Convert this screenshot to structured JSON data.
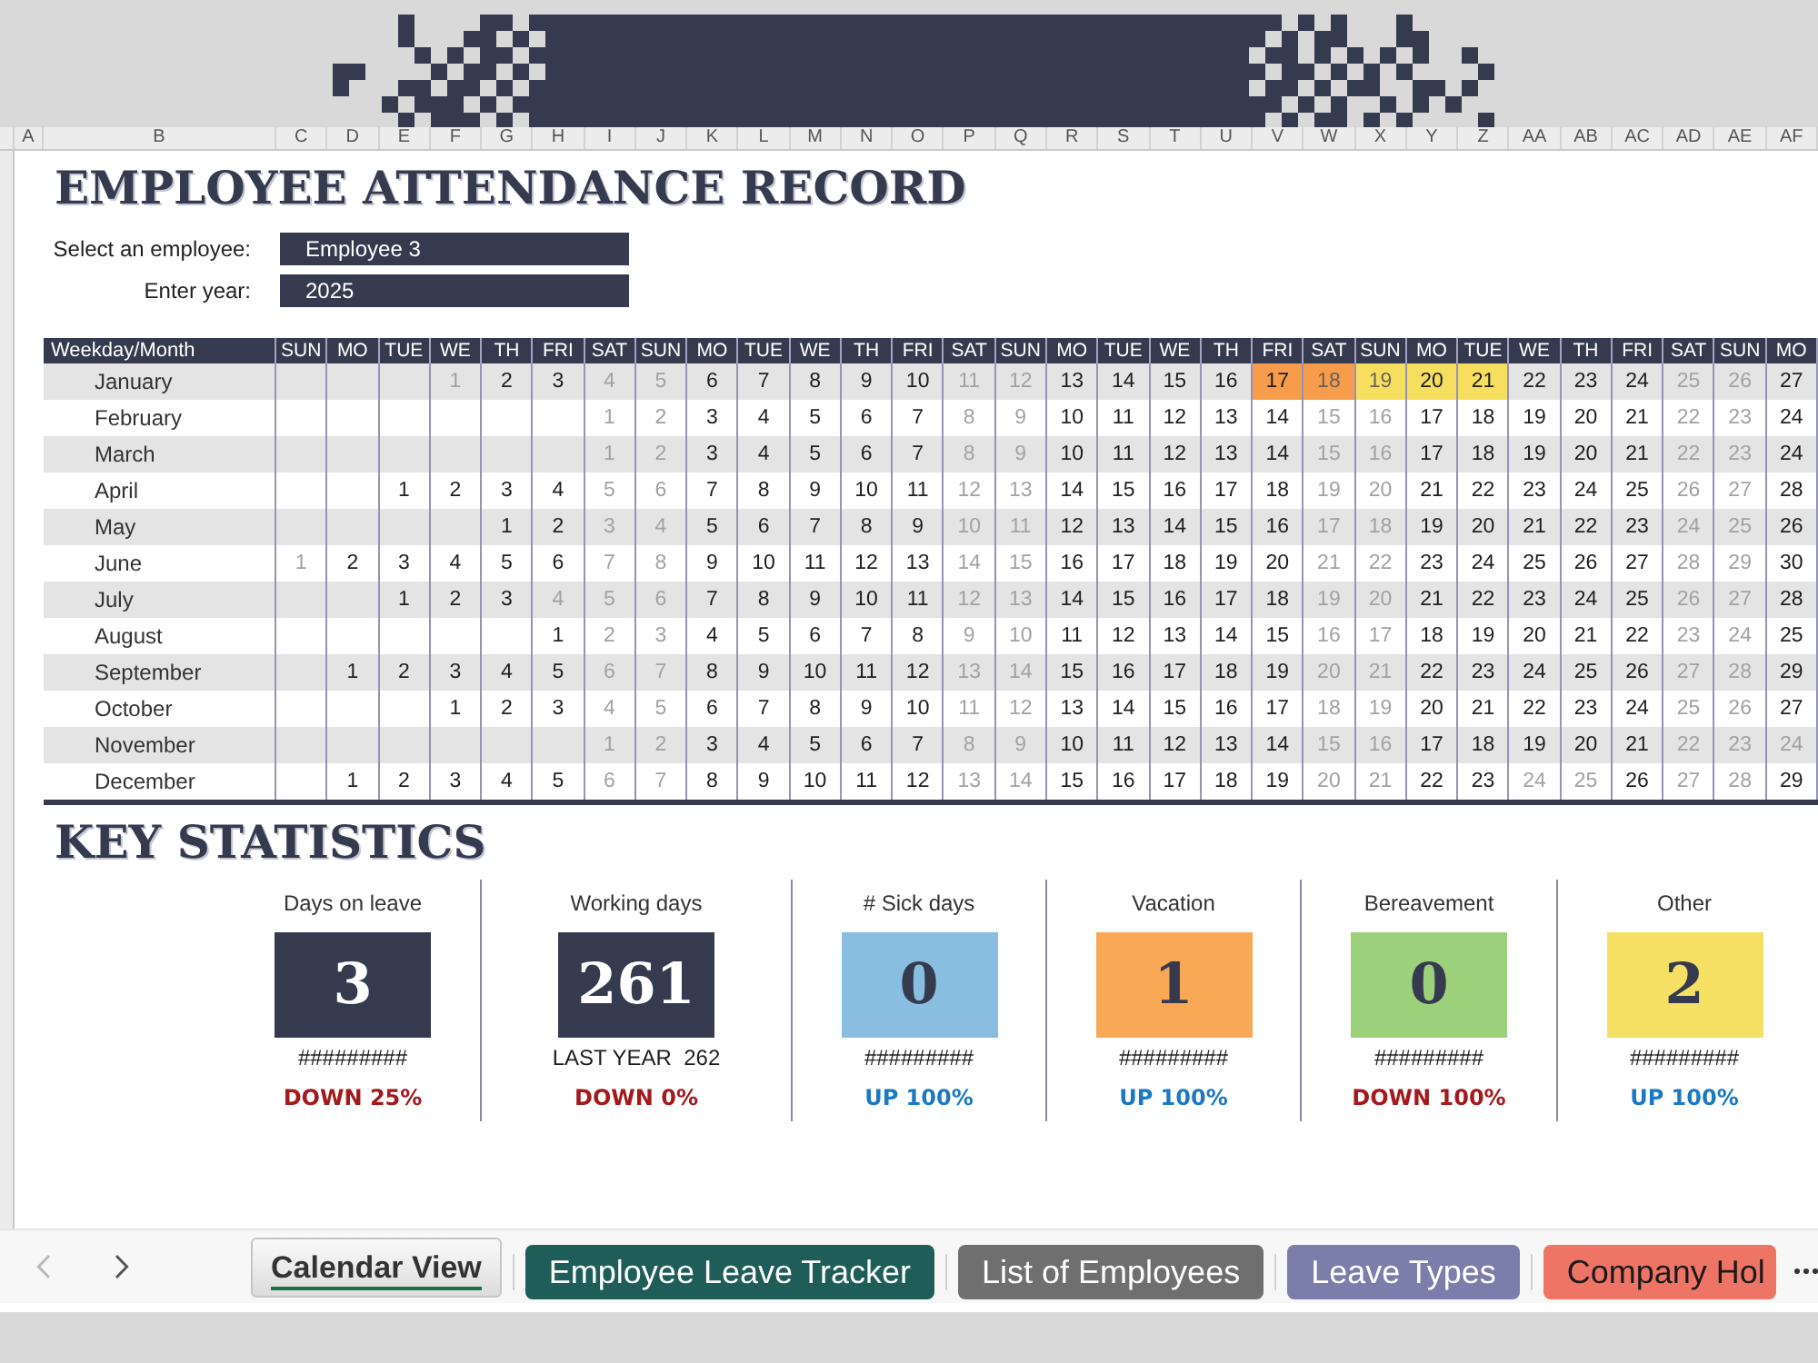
{
  "column_headers": [
    "A",
    "B",
    "C",
    "D",
    "E",
    "F",
    "G",
    "H",
    "I",
    "J",
    "K",
    "L",
    "M",
    "N",
    "O",
    "P",
    "Q",
    "R",
    "S",
    "T",
    "U",
    "V",
    "W",
    "X",
    "Y",
    "Z",
    "AA",
    "AB",
    "AC",
    "AD",
    "AE",
    "AF"
  ],
  "title": "EMPLOYEE ATTENDANCE RECORD",
  "selectors": [
    {
      "label": "Select an employee:",
      "value": "Employee 3"
    },
    {
      "label": "Enter year:",
      "value": "2025"
    }
  ],
  "calendar": {
    "corner": "Weekday/Month",
    "weekdays": [
      "SUN",
      "MO",
      "TUE",
      "WE",
      "TH",
      "FRI",
      "SAT",
      "SUN",
      "MO",
      "TUE",
      "WE",
      "TH",
      "FRI",
      "SAT",
      "SUN",
      "MO",
      "TUE",
      "WE",
      "TH",
      "FRI",
      "SAT",
      "SUN",
      "MO",
      "TUE",
      "WE",
      "TH",
      "FRI",
      "SAT",
      "SUN",
      "MO"
    ],
    "months": [
      {
        "name": "January",
        "days": [
          {
            "kind": "blank"
          },
          {
            "kind": "blank"
          },
          {
            "kind": "blank"
          },
          {
            "kind": "day",
            "day": "1",
            "off": true
          },
          {
            "kind": "day",
            "day": "2",
            "off": false
          },
          {
            "kind": "day",
            "day": "3",
            "off": false
          },
          {
            "kind": "day",
            "day": "4",
            "off": true
          },
          {
            "kind": "day",
            "day": "5",
            "off": true
          },
          {
            "kind": "day",
            "day": "6",
            "off": false
          },
          {
            "kind": "day",
            "day": "7",
            "off": false
          },
          {
            "kind": "day",
            "day": "8",
            "off": false
          },
          {
            "kind": "day",
            "day": "9",
            "off": false
          },
          {
            "kind": "day",
            "day": "10",
            "off": false
          },
          {
            "kind": "day",
            "day": "11",
            "off": true
          },
          {
            "kind": "day",
            "day": "12",
            "off": true
          },
          {
            "kind": "day",
            "day": "13",
            "off": false
          },
          {
            "kind": "day",
            "day": "14",
            "off": false
          },
          {
            "kind": "day",
            "day": "15",
            "off": false
          },
          {
            "kind": "day",
            "day": "16",
            "off": false
          },
          {
            "kind": "day",
            "day": "17",
            "off": false,
            "color": "#f79c4a"
          },
          {
            "kind": "day",
            "day": "18",
            "off": true,
            "color": "#f79c4a"
          },
          {
            "kind": "day",
            "day": "19",
            "off": true,
            "color": "#f6df5f"
          },
          {
            "kind": "day",
            "day": "20",
            "off": false,
            "color": "#f6df5f"
          },
          {
            "kind": "day",
            "day": "21",
            "off": false,
            "color": "#f6df5f"
          },
          {
            "kind": "day",
            "day": "22",
            "off": false
          },
          {
            "kind": "day",
            "day": "23",
            "off": false
          },
          {
            "kind": "day",
            "day": "24",
            "off": false
          },
          {
            "kind": "day",
            "day": "25",
            "off": true
          },
          {
            "kind": "day",
            "day": "26",
            "off": true
          },
          {
            "kind": "day",
            "day": "27",
            "off": false
          }
        ]
      },
      {
        "name": "February",
        "days": [
          {
            "kind": "blank"
          },
          {
            "kind": "blank"
          },
          {
            "kind": "blank"
          },
          {
            "kind": "blank"
          },
          {
            "kind": "blank"
          },
          {
            "kind": "blank"
          },
          {
            "kind": "day",
            "day": "1",
            "off": true
          },
          {
            "kind": "day",
            "day": "2",
            "off": true
          },
          {
            "kind": "day",
            "day": "3",
            "off": false
          },
          {
            "kind": "day",
            "day": "4",
            "off": false
          },
          {
            "kind": "day",
            "day": "5",
            "off": false
          },
          {
            "kind": "day",
            "day": "6",
            "off": false
          },
          {
            "kind": "day",
            "day": "7",
            "off": false
          },
          {
            "kind": "day",
            "day": "8",
            "off": true
          },
          {
            "kind": "day",
            "day": "9",
            "off": true
          },
          {
            "kind": "day",
            "day": "10",
            "off": false
          },
          {
            "kind": "day",
            "day": "11",
            "off": false
          },
          {
            "kind": "day",
            "day": "12",
            "off": false
          },
          {
            "kind": "day",
            "day": "13",
            "off": false
          },
          {
            "kind": "day",
            "day": "14",
            "off": false
          },
          {
            "kind": "day",
            "day": "15",
            "off": true
          },
          {
            "kind": "day",
            "day": "16",
            "off": true
          },
          {
            "kind": "day",
            "day": "17",
            "off": false
          },
          {
            "kind": "day",
            "day": "18",
            "off": false
          },
          {
            "kind": "day",
            "day": "19",
            "off": false
          },
          {
            "kind": "day",
            "day": "20",
            "off": false
          },
          {
            "kind": "day",
            "day": "21",
            "off": false
          },
          {
            "kind": "day",
            "day": "22",
            "off": true
          },
          {
            "kind": "day",
            "day": "23",
            "off": true
          },
          {
            "kind": "day",
            "day": "24",
            "off": false
          }
        ]
      },
      {
        "name": "March",
        "days": [
          {
            "kind": "blank"
          },
          {
            "kind": "blank"
          },
          {
            "kind": "blank"
          },
          {
            "kind": "blank"
          },
          {
            "kind": "blank"
          },
          {
            "kind": "blank"
          },
          {
            "kind": "day",
            "day": "1",
            "off": true
          },
          {
            "kind": "day",
            "day": "2",
            "off": true
          },
          {
            "kind": "day",
            "day": "3",
            "off": false
          },
          {
            "kind": "day",
            "day": "4",
            "off": false
          },
          {
            "kind": "day",
            "day": "5",
            "off": false
          },
          {
            "kind": "day",
            "day": "6",
            "off": false
          },
          {
            "kind": "day",
            "day": "7",
            "off": false
          },
          {
            "kind": "day",
            "day": "8",
            "off": true
          },
          {
            "kind": "day",
            "day": "9",
            "off": true
          },
          {
            "kind": "day",
            "day": "10",
            "off": false
          },
          {
            "kind": "day",
            "day": "11",
            "off": false
          },
          {
            "kind": "day",
            "day": "12",
            "off": false
          },
          {
            "kind": "day",
            "day": "13",
            "off": false
          },
          {
            "kind": "day",
            "day": "14",
            "off": false
          },
          {
            "kind": "day",
            "day": "15",
            "off": true
          },
          {
            "kind": "day",
            "day": "16",
            "off": true
          },
          {
            "kind": "day",
            "day": "17",
            "off": false
          },
          {
            "kind": "day",
            "day": "18",
            "off": false
          },
          {
            "kind": "day",
            "day": "19",
            "off": false
          },
          {
            "kind": "day",
            "day": "20",
            "off": false
          },
          {
            "kind": "day",
            "day": "21",
            "off": false
          },
          {
            "kind": "day",
            "day": "22",
            "off": true
          },
          {
            "kind": "day",
            "day": "23",
            "off": true
          },
          {
            "kind": "day",
            "day": "24",
            "off": false
          }
        ]
      },
      {
        "name": "April",
        "days": [
          {
            "kind": "blank"
          },
          {
            "kind": "blank"
          },
          {
            "kind": "day",
            "day": "1",
            "off": false
          },
          {
            "kind": "day",
            "day": "2",
            "off": false
          },
          {
            "kind": "day",
            "day": "3",
            "off": false
          },
          {
            "kind": "day",
            "day": "4",
            "off": false
          },
          {
            "kind": "day",
            "day": "5",
            "off": true
          },
          {
            "kind": "day",
            "day": "6",
            "off": true
          },
          {
            "kind": "day",
            "day": "7",
            "off": false
          },
          {
            "kind": "day",
            "day": "8",
            "off": false
          },
          {
            "kind": "day",
            "day": "9",
            "off": false
          },
          {
            "kind": "day",
            "day": "10",
            "off": false
          },
          {
            "kind": "day",
            "day": "11",
            "off": false
          },
          {
            "kind": "day",
            "day": "12",
            "off": true
          },
          {
            "kind": "day",
            "day": "13",
            "off": true
          },
          {
            "kind": "day",
            "day": "14",
            "off": false
          },
          {
            "kind": "day",
            "day": "15",
            "off": false
          },
          {
            "kind": "day",
            "day": "16",
            "off": false
          },
          {
            "kind": "day",
            "day": "17",
            "off": false
          },
          {
            "kind": "day",
            "day": "18",
            "off": false
          },
          {
            "kind": "day",
            "day": "19",
            "off": true
          },
          {
            "kind": "day",
            "day": "20",
            "off": true
          },
          {
            "kind": "day",
            "day": "21",
            "off": false
          },
          {
            "kind": "day",
            "day": "22",
            "off": false
          },
          {
            "kind": "day",
            "day": "23",
            "off": false
          },
          {
            "kind": "day",
            "day": "24",
            "off": false
          },
          {
            "kind": "day",
            "day": "25",
            "off": false
          },
          {
            "kind": "day",
            "day": "26",
            "off": true
          },
          {
            "kind": "day",
            "day": "27",
            "off": true
          },
          {
            "kind": "day",
            "day": "28",
            "off": false
          }
        ]
      },
      {
        "name": "May",
        "days": [
          {
            "kind": "blank"
          },
          {
            "kind": "blank"
          },
          {
            "kind": "blank"
          },
          {
            "kind": "blank"
          },
          {
            "kind": "day",
            "day": "1",
            "off": false
          },
          {
            "kind": "day",
            "day": "2",
            "off": false
          },
          {
            "kind": "day",
            "day": "3",
            "off": true
          },
          {
            "kind": "day",
            "day": "4",
            "off": true
          },
          {
            "kind": "day",
            "day": "5",
            "off": false
          },
          {
            "kind": "day",
            "day": "6",
            "off": false
          },
          {
            "kind": "day",
            "day": "7",
            "off": false
          },
          {
            "kind": "day",
            "day": "8",
            "off": false
          },
          {
            "kind": "day",
            "day": "9",
            "off": false
          },
          {
            "kind": "day",
            "day": "10",
            "off": true
          },
          {
            "kind": "day",
            "day": "11",
            "off": true
          },
          {
            "kind": "day",
            "day": "12",
            "off": false
          },
          {
            "kind": "day",
            "day": "13",
            "off": false
          },
          {
            "kind": "day",
            "day": "14",
            "off": false
          },
          {
            "kind": "day",
            "day": "15",
            "off": false
          },
          {
            "kind": "day",
            "day": "16",
            "off": false
          },
          {
            "kind": "day",
            "day": "17",
            "off": true
          },
          {
            "kind": "day",
            "day": "18",
            "off": true
          },
          {
            "kind": "day",
            "day": "19",
            "off": false
          },
          {
            "kind": "day",
            "day": "20",
            "off": false
          },
          {
            "kind": "day",
            "day": "21",
            "off": false
          },
          {
            "kind": "day",
            "day": "22",
            "off": false
          },
          {
            "kind": "day",
            "day": "23",
            "off": false
          },
          {
            "kind": "day",
            "day": "24",
            "off": true
          },
          {
            "kind": "day",
            "day": "25",
            "off": true
          },
          {
            "kind": "day",
            "day": "26",
            "off": false
          }
        ]
      },
      {
        "name": "June",
        "days": [
          {
            "kind": "day",
            "day": "1",
            "off": true
          },
          {
            "kind": "day",
            "day": "2",
            "off": false
          },
          {
            "kind": "day",
            "day": "3",
            "off": false
          },
          {
            "kind": "day",
            "day": "4",
            "off": false
          },
          {
            "kind": "day",
            "day": "5",
            "off": false
          },
          {
            "kind": "day",
            "day": "6",
            "off": false
          },
          {
            "kind": "day",
            "day": "7",
            "off": true
          },
          {
            "kind": "day",
            "day": "8",
            "off": true
          },
          {
            "kind": "day",
            "day": "9",
            "off": false
          },
          {
            "kind": "day",
            "day": "10",
            "off": false
          },
          {
            "kind": "day",
            "day": "11",
            "off": false
          },
          {
            "kind": "day",
            "day": "12",
            "off": false
          },
          {
            "kind": "day",
            "day": "13",
            "off": false
          },
          {
            "kind": "day",
            "day": "14",
            "off": true
          },
          {
            "kind": "day",
            "day": "15",
            "off": true
          },
          {
            "kind": "day",
            "day": "16",
            "off": false
          },
          {
            "kind": "day",
            "day": "17",
            "off": false
          },
          {
            "kind": "day",
            "day": "18",
            "off": false
          },
          {
            "kind": "day",
            "day": "19",
            "off": false
          },
          {
            "kind": "day",
            "day": "20",
            "off": false
          },
          {
            "kind": "day",
            "day": "21",
            "off": true
          },
          {
            "kind": "day",
            "day": "22",
            "off": true
          },
          {
            "kind": "day",
            "day": "23",
            "off": false
          },
          {
            "kind": "day",
            "day": "24",
            "off": false
          },
          {
            "kind": "day",
            "day": "25",
            "off": false
          },
          {
            "kind": "day",
            "day": "26",
            "off": false
          },
          {
            "kind": "day",
            "day": "27",
            "off": false
          },
          {
            "kind": "day",
            "day": "28",
            "off": true
          },
          {
            "kind": "day",
            "day": "29",
            "off": true
          },
          {
            "kind": "day",
            "day": "30",
            "off": false
          }
        ]
      },
      {
        "name": "July",
        "days": [
          {
            "kind": "blank"
          },
          {
            "kind": "blank"
          },
          {
            "kind": "day",
            "day": "1",
            "off": false
          },
          {
            "kind": "day",
            "day": "2",
            "off": false
          },
          {
            "kind": "day",
            "day": "3",
            "off": false
          },
          {
            "kind": "day",
            "day": "4",
            "off": true
          },
          {
            "kind": "day",
            "day": "5",
            "off": true
          },
          {
            "kind": "day",
            "day": "6",
            "off": true
          },
          {
            "kind": "day",
            "day": "7",
            "off": false
          },
          {
            "kind": "day",
            "day": "8",
            "off": false
          },
          {
            "kind": "day",
            "day": "9",
            "off": false
          },
          {
            "kind": "day",
            "day": "10",
            "off": false
          },
          {
            "kind": "day",
            "day": "11",
            "off": false
          },
          {
            "kind": "day",
            "day": "12",
            "off": true
          },
          {
            "kind": "day",
            "day": "13",
            "off": true
          },
          {
            "kind": "day",
            "day": "14",
            "off": false
          },
          {
            "kind": "day",
            "day": "15",
            "off": false
          },
          {
            "kind": "day",
            "day": "16",
            "off": false
          },
          {
            "kind": "day",
            "day": "17",
            "off": false
          },
          {
            "kind": "day",
            "day": "18",
            "off": false
          },
          {
            "kind": "day",
            "day": "19",
            "off": true
          },
          {
            "kind": "day",
            "day": "20",
            "off": true
          },
          {
            "kind": "day",
            "day": "21",
            "off": false
          },
          {
            "kind": "day",
            "day": "22",
            "off": false
          },
          {
            "kind": "day",
            "day": "23",
            "off": false
          },
          {
            "kind": "day",
            "day": "24",
            "off": false
          },
          {
            "kind": "day",
            "day": "25",
            "off": false
          },
          {
            "kind": "day",
            "day": "26",
            "off": true
          },
          {
            "kind": "day",
            "day": "27",
            "off": true
          },
          {
            "kind": "day",
            "day": "28",
            "off": false
          }
        ]
      },
      {
        "name": "August",
        "days": [
          {
            "kind": "blank"
          },
          {
            "kind": "blank"
          },
          {
            "kind": "blank"
          },
          {
            "kind": "blank"
          },
          {
            "kind": "blank"
          },
          {
            "kind": "day",
            "day": "1",
            "off": false
          },
          {
            "kind": "day",
            "day": "2",
            "off": true
          },
          {
            "kind": "day",
            "day": "3",
            "off": true
          },
          {
            "kind": "day",
            "day": "4",
            "off": false
          },
          {
            "kind": "day",
            "day": "5",
            "off": false
          },
          {
            "kind": "day",
            "day": "6",
            "off": false
          },
          {
            "kind": "day",
            "day": "7",
            "off": false
          },
          {
            "kind": "day",
            "day": "8",
            "off": false
          },
          {
            "kind": "day",
            "day": "9",
            "off": true
          },
          {
            "kind": "day",
            "day": "10",
            "off": true
          },
          {
            "kind": "day",
            "day": "11",
            "off": false
          },
          {
            "kind": "day",
            "day": "12",
            "off": false
          },
          {
            "kind": "day",
            "day": "13",
            "off": false
          },
          {
            "kind": "day",
            "day": "14",
            "off": false
          },
          {
            "kind": "day",
            "day": "15",
            "off": false
          },
          {
            "kind": "day",
            "day": "16",
            "off": true
          },
          {
            "kind": "day",
            "day": "17",
            "off": true
          },
          {
            "kind": "day",
            "day": "18",
            "off": false
          },
          {
            "kind": "day",
            "day": "19",
            "off": false
          },
          {
            "kind": "day",
            "day": "20",
            "off": false
          },
          {
            "kind": "day",
            "day": "21",
            "off": false
          },
          {
            "kind": "day",
            "day": "22",
            "off": false
          },
          {
            "kind": "day",
            "day": "23",
            "off": true
          },
          {
            "kind": "day",
            "day": "24",
            "off": true
          },
          {
            "kind": "day",
            "day": "25",
            "off": false
          }
        ]
      },
      {
        "name": "September",
        "days": [
          {
            "kind": "blank"
          },
          {
            "kind": "day",
            "day": "1",
            "off": false
          },
          {
            "kind": "day",
            "day": "2",
            "off": false
          },
          {
            "kind": "day",
            "day": "3",
            "off": false
          },
          {
            "kind": "day",
            "day": "4",
            "off": false
          },
          {
            "kind": "day",
            "day": "5",
            "off": false
          },
          {
            "kind": "day",
            "day": "6",
            "off": true
          },
          {
            "kind": "day",
            "day": "7",
            "off": true
          },
          {
            "kind": "day",
            "day": "8",
            "off": false
          },
          {
            "kind": "day",
            "day": "9",
            "off": false
          },
          {
            "kind": "day",
            "day": "10",
            "off": false
          },
          {
            "kind": "day",
            "day": "11",
            "off": false
          },
          {
            "kind": "day",
            "day": "12",
            "off": false
          },
          {
            "kind": "day",
            "day": "13",
            "off": true
          },
          {
            "kind": "day",
            "day": "14",
            "off": true
          },
          {
            "kind": "day",
            "day": "15",
            "off": false
          },
          {
            "kind": "day",
            "day": "16",
            "off": false
          },
          {
            "kind": "day",
            "day": "17",
            "off": false
          },
          {
            "kind": "day",
            "day": "18",
            "off": false
          },
          {
            "kind": "day",
            "day": "19",
            "off": false
          },
          {
            "kind": "day",
            "day": "20",
            "off": true
          },
          {
            "kind": "day",
            "day": "21",
            "off": true
          },
          {
            "kind": "day",
            "day": "22",
            "off": false
          },
          {
            "kind": "day",
            "day": "23",
            "off": false
          },
          {
            "kind": "day",
            "day": "24",
            "off": false
          },
          {
            "kind": "day",
            "day": "25",
            "off": false
          },
          {
            "kind": "day",
            "day": "26",
            "off": false
          },
          {
            "kind": "day",
            "day": "27",
            "off": true
          },
          {
            "kind": "day",
            "day": "28",
            "off": true
          },
          {
            "kind": "day",
            "day": "29",
            "off": false
          }
        ]
      },
      {
        "name": "October",
        "days": [
          {
            "kind": "blank"
          },
          {
            "kind": "blank"
          },
          {
            "kind": "blank"
          },
          {
            "kind": "day",
            "day": "1",
            "off": false
          },
          {
            "kind": "day",
            "day": "2",
            "off": false
          },
          {
            "kind": "day",
            "day": "3",
            "off": false
          },
          {
            "kind": "day",
            "day": "4",
            "off": true
          },
          {
            "kind": "day",
            "day": "5",
            "off": true
          },
          {
            "kind": "day",
            "day": "6",
            "off": false
          },
          {
            "kind": "day",
            "day": "7",
            "off": false
          },
          {
            "kind": "day",
            "day": "8",
            "off": false
          },
          {
            "kind": "day",
            "day": "9",
            "off": false
          },
          {
            "kind": "day",
            "day": "10",
            "off": false
          },
          {
            "kind": "day",
            "day": "11",
            "off": true
          },
          {
            "kind": "day",
            "day": "12",
            "off": true
          },
          {
            "kind": "day",
            "day": "13",
            "off": false
          },
          {
            "kind": "day",
            "day": "14",
            "off": false
          },
          {
            "kind": "day",
            "day": "15",
            "off": false
          },
          {
            "kind": "day",
            "day": "16",
            "off": false
          },
          {
            "kind": "day",
            "day": "17",
            "off": false
          },
          {
            "kind": "day",
            "day": "18",
            "off": true
          },
          {
            "kind": "day",
            "day": "19",
            "off": true
          },
          {
            "kind": "day",
            "day": "20",
            "off": false
          },
          {
            "kind": "day",
            "day": "21",
            "off": false
          },
          {
            "kind": "day",
            "day": "22",
            "off": false
          },
          {
            "kind": "day",
            "day": "23",
            "off": false
          },
          {
            "kind": "day",
            "day": "24",
            "off": false
          },
          {
            "kind": "day",
            "day": "25",
            "off": true
          },
          {
            "kind": "day",
            "day": "26",
            "off": true
          },
          {
            "kind": "day",
            "day": "27",
            "off": false
          }
        ]
      },
      {
        "name": "November",
        "days": [
          {
            "kind": "blank"
          },
          {
            "kind": "blank"
          },
          {
            "kind": "blank"
          },
          {
            "kind": "blank"
          },
          {
            "kind": "blank"
          },
          {
            "kind": "blank"
          },
          {
            "kind": "day",
            "day": "1",
            "off": true
          },
          {
            "kind": "day",
            "day": "2",
            "off": true
          },
          {
            "kind": "day",
            "day": "3",
            "off": false
          },
          {
            "kind": "day",
            "day": "4",
            "off": false
          },
          {
            "kind": "day",
            "day": "5",
            "off": false
          },
          {
            "kind": "day",
            "day": "6",
            "off": false
          },
          {
            "kind": "day",
            "day": "7",
            "off": false
          },
          {
            "kind": "day",
            "day": "8",
            "off": true
          },
          {
            "kind": "day",
            "day": "9",
            "off": true
          },
          {
            "kind": "day",
            "day": "10",
            "off": false
          },
          {
            "kind": "day",
            "day": "11",
            "off": false
          },
          {
            "kind": "day",
            "day": "12",
            "off": false
          },
          {
            "kind": "day",
            "day": "13",
            "off": false
          },
          {
            "kind": "day",
            "day": "14",
            "off": false
          },
          {
            "kind": "day",
            "day": "15",
            "off": true
          },
          {
            "kind": "day",
            "day": "16",
            "off": true
          },
          {
            "kind": "day",
            "day": "17",
            "off": false
          },
          {
            "kind": "day",
            "day": "18",
            "off": false
          },
          {
            "kind": "day",
            "day": "19",
            "off": false
          },
          {
            "kind": "day",
            "day": "20",
            "off": false
          },
          {
            "kind": "day",
            "day": "21",
            "off": false
          },
          {
            "kind": "day",
            "day": "22",
            "off": true
          },
          {
            "kind": "day",
            "day": "23",
            "off": true
          },
          {
            "kind": "day",
            "day": "24",
            "off": true
          }
        ]
      },
      {
        "name": "December",
        "days": [
          {
            "kind": "blank"
          },
          {
            "kind": "day",
            "day": "1",
            "off": false
          },
          {
            "kind": "day",
            "day": "2",
            "off": false
          },
          {
            "kind": "day",
            "day": "3",
            "off": false
          },
          {
            "kind": "day",
            "day": "4",
            "off": false
          },
          {
            "kind": "day",
            "day": "5",
            "off": false
          },
          {
            "kind": "day",
            "day": "6",
            "off": true
          },
          {
            "kind": "day",
            "day": "7",
            "off": true
          },
          {
            "kind": "day",
            "day": "8",
            "off": false
          },
          {
            "kind": "day",
            "day": "9",
            "off": false
          },
          {
            "kind": "day",
            "day": "10",
            "off": false
          },
          {
            "kind": "day",
            "day": "11",
            "off": false
          },
          {
            "kind": "day",
            "day": "12",
            "off": false
          },
          {
            "kind": "day",
            "day": "13",
            "off": true
          },
          {
            "kind": "day",
            "day": "14",
            "off": true
          },
          {
            "kind": "day",
            "day": "15",
            "off": false
          },
          {
            "kind": "day",
            "day": "16",
            "off": false
          },
          {
            "kind": "day",
            "day": "17",
            "off": false
          },
          {
            "kind": "day",
            "day": "18",
            "off": false
          },
          {
            "kind": "day",
            "day": "19",
            "off": false
          },
          {
            "kind": "day",
            "day": "20",
            "off": true
          },
          {
            "kind": "day",
            "day": "21",
            "off": true
          },
          {
            "kind": "day",
            "day": "22",
            "off": false
          },
          {
            "kind": "day",
            "day": "23",
            "off": false
          },
          {
            "kind": "day",
            "day": "24",
            "off": true
          },
          {
            "kind": "day",
            "day": "25",
            "off": true
          },
          {
            "kind": "day",
            "day": "26",
            "off": false
          },
          {
            "kind": "day",
            "day": "27",
            "off": true
          },
          {
            "kind": "day",
            "day": "28",
            "off": true
          },
          {
            "kind": "day",
            "day": "29",
            "off": false
          }
        ]
      }
    ]
  },
  "statistics": {
    "title": "KEY STATISTICS",
    "items": [
      {
        "label": "Days on leave",
        "value": "3",
        "color": "#363a4f",
        "note": "#########",
        "trend": {
          "text": "DOWN 25%",
          "kind": "down"
        }
      },
      {
        "label": "Working days",
        "value": "261",
        "color": "#363a4f",
        "note": "LAST YEAR  262",
        "trend": {
          "text": "DOWN 0%",
          "kind": "down"
        }
      },
      {
        "label": "# Sick days",
        "value": "0",
        "color": "#89bee0",
        "note": "#########",
        "trend": {
          "text": "UP 100%",
          "kind": "up"
        }
      },
      {
        "label": "Vacation",
        "value": "1",
        "color": "#f9a856",
        "note": "#########",
        "trend": {
          "text": "UP 100%",
          "kind": "up"
        }
      },
      {
        "label": "Bereavement",
        "value": "0",
        "color": "#9dd07a",
        "note": "#########",
        "trend": {
          "text": "DOWN 100%",
          "kind": "down"
        }
      },
      {
        "label": "Other",
        "value": "2",
        "color": "#f5e064",
        "note": "#########",
        "trend": {
          "text": "UP 100%",
          "kind": "up"
        }
      }
    ]
  },
  "sheet_navigation": {
    "back": {
      "disabled": true
    },
    "forward": {
      "disabled": false
    }
  },
  "sheet_tabs": [
    {
      "label": "Calendar View",
      "selected": true
    },
    {
      "label": "Employee Leave Tracker",
      "selected": false,
      "color": "#1f5e58"
    },
    {
      "label": "List of Employees",
      "selected": false,
      "color": "#6f6f6f"
    },
    {
      "label": "Leave Types",
      "selected": false,
      "color": "#7b7dab"
    },
    {
      "label": "Company Hol",
      "selected": false,
      "color": "#ee7565"
    }
  ]
}
